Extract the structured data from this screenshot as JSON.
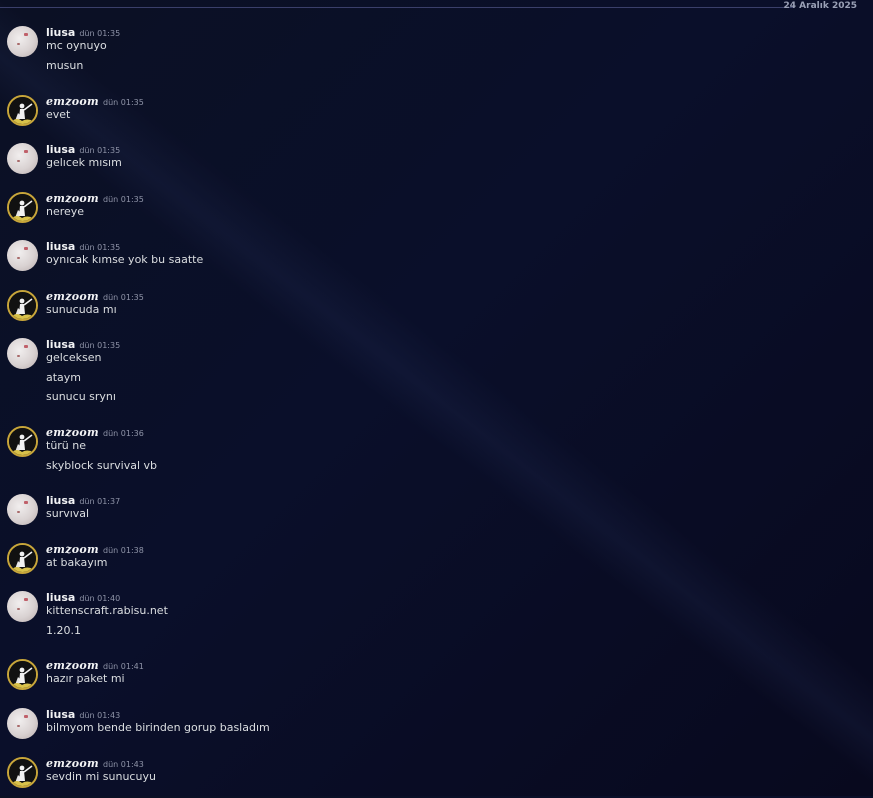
{
  "date_divider": "24 Aralık 2025",
  "colors": {
    "background": "#0a0f2a",
    "text": "#dbdee1",
    "username": "#f2f3f5",
    "timestamp": "#8f94a8",
    "emzoom_border": "#c8a63a"
  },
  "messages": [
    {
      "user": "liusa",
      "avatar": "liusa-avatar-icon",
      "time": "dün 01:35",
      "lines": [
        "mc oynuyo",
        "musun"
      ]
    },
    {
      "user": "emzoom",
      "avatar": "emzoom-avatar-icon",
      "time": "dün 01:35",
      "lines": [
        "evet"
      ]
    },
    {
      "user": "liusa",
      "avatar": "liusa-avatar-icon",
      "time": "dün 01:35",
      "lines": [
        "gelıcek mısım"
      ]
    },
    {
      "user": "emzoom",
      "avatar": "emzoom-avatar-icon",
      "time": "dün 01:35",
      "lines": [
        "nereye"
      ]
    },
    {
      "user": "liusa",
      "avatar": "liusa-avatar-icon",
      "time": "dün 01:35",
      "lines": [
        "oynıcak kımse yok bu saatte"
      ]
    },
    {
      "user": "emzoom",
      "avatar": "emzoom-avatar-icon",
      "time": "dün 01:35",
      "lines": [
        "sunucuda mı"
      ]
    },
    {
      "user": "liusa",
      "avatar": "liusa-avatar-icon",
      "time": "dün 01:35",
      "lines": [
        "gelceksen",
        "ataym",
        "sunucu srynı"
      ]
    },
    {
      "user": "emzoom",
      "avatar": "emzoom-avatar-icon",
      "time": "dün 01:36",
      "lines": [
        "türü ne",
        "skyblock survival vb"
      ]
    },
    {
      "user": "liusa",
      "avatar": "liusa-avatar-icon",
      "time": "dün 01:37",
      "lines": [
        "survıval"
      ]
    },
    {
      "user": "emzoom",
      "avatar": "emzoom-avatar-icon",
      "time": "dün 01:38",
      "lines": [
        "at bakayım"
      ]
    },
    {
      "user": "liusa",
      "avatar": "liusa-avatar-icon",
      "time": "dün 01:40",
      "lines": [
        "kittenscraft.rabisu.net",
        "1.20.1"
      ]
    },
    {
      "user": "emzoom",
      "avatar": "emzoom-avatar-icon",
      "time": "dün 01:41",
      "lines": [
        "hazır paket mi"
      ]
    },
    {
      "user": "liusa",
      "avatar": "liusa-avatar-icon",
      "time": "dün 01:43",
      "lines": [
        "bilmyom bende birinden gorup basladım"
      ]
    },
    {
      "user": "emzoom",
      "avatar": "emzoom-avatar-icon",
      "time": "dün 01:43",
      "lines": [
        "sevdin mi sunucuyu"
      ]
    }
  ]
}
